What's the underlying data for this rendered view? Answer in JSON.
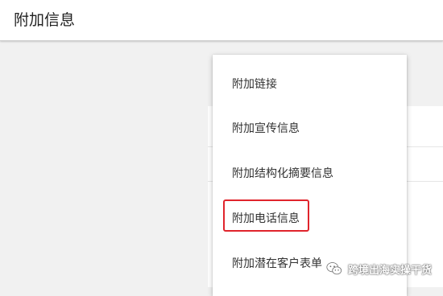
{
  "header": {
    "title": "附加信息"
  },
  "menu": {
    "items": [
      {
        "label": "附加链接"
      },
      {
        "label": "附加宣传信息"
      },
      {
        "label": "附加结构化摘要信息"
      },
      {
        "label": "附加电话信息"
      },
      {
        "label": "附加潜在客户表单"
      }
    ],
    "highlighted_index": 3
  },
  "watermark": {
    "text": "跨境出海实操干货",
    "icon": "wechat-icon"
  },
  "colors": {
    "background": "#f1f1f1",
    "surface": "#ffffff",
    "highlight_border": "#e0242c"
  }
}
